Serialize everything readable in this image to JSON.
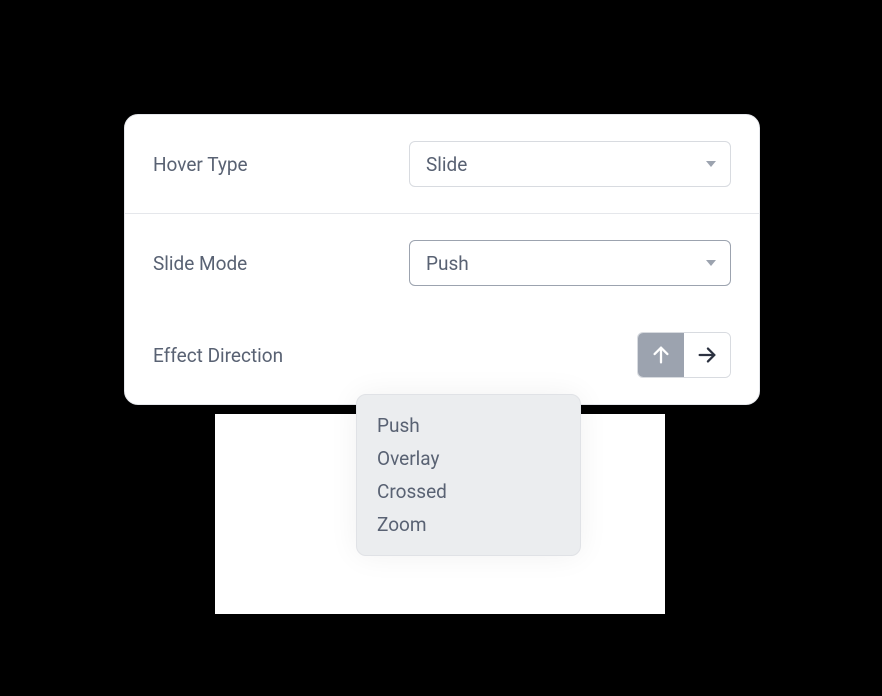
{
  "settings": {
    "hover_type": {
      "label": "Hover Type",
      "value": "Slide"
    },
    "slide_mode": {
      "label": "Slide Mode",
      "value": "Push",
      "options": [
        "Push",
        "Overlay",
        "Crossed",
        "Zoom"
      ]
    },
    "effect_direction": {
      "label": "Effect Direction",
      "active": "up"
    }
  }
}
